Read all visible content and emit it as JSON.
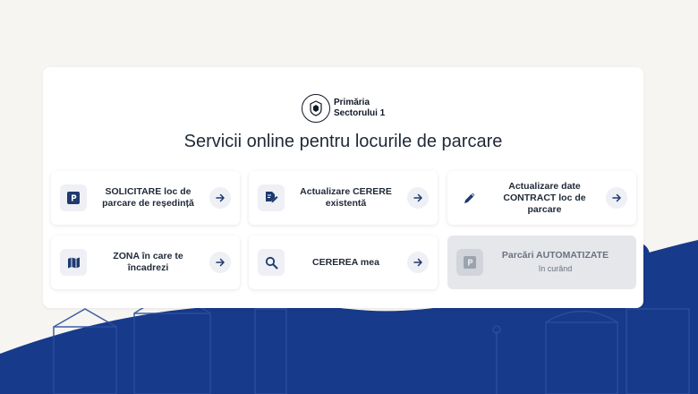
{
  "brand": {
    "line1": "Primăria",
    "line2": "Sectorului 1"
  },
  "page_title": "Servicii online pentru locurile de parcare",
  "tiles": [
    {
      "label": "SOLICITARE loc de parcare de reședință",
      "icon": "parking-icon"
    },
    {
      "label": "Actualizare CERERE existentă",
      "icon": "edit-document-icon"
    },
    {
      "label": "Actualizare date CONTRACT loc de parcare",
      "icon": "pencil-icon"
    },
    {
      "label": "ZONA în care te încadrezi",
      "icon": "map-icon"
    },
    {
      "label": "CEREREA mea",
      "icon": "search-icon"
    },
    {
      "label": "Parcări AUTOMATIZATE",
      "sublabel": "în curând",
      "icon": "parking-icon",
      "disabled": true
    }
  ],
  "colors": {
    "page_background": "#f7f5f2",
    "brand_blue": "#173a8a",
    "icon_navy": "#1e3a6e",
    "tile_icon_background": "#eef0f5",
    "disabled_tile": "#e5e7eb"
  }
}
